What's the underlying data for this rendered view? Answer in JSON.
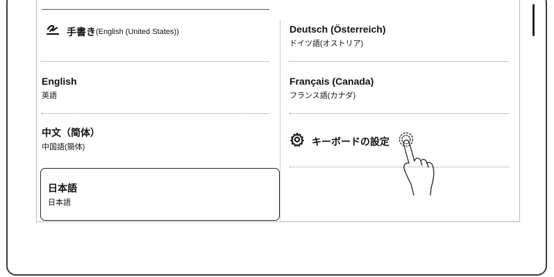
{
  "left_column": [
    {
      "title": "手書き",
      "title_suffix": "(English (United States))",
      "icon": "handwriting-icon",
      "sub": ""
    },
    {
      "title": "English",
      "sub": "英語"
    },
    {
      "title": "中文（简体）",
      "sub": "中国語(簡体)"
    },
    {
      "title": "日本語",
      "sub": "日本語",
      "selected": true
    }
  ],
  "right_column": [
    {
      "title": "Deutsch (Österreich)",
      "sub": "ドイツ語(オストリア)"
    },
    {
      "title": "Français (Canada)",
      "sub": "フランス語(カナダ)"
    },
    {
      "title": "キーボードの設定",
      "icon": "gear-icon"
    }
  ],
  "overlay": {
    "gesture": "tap-hand-icon"
  }
}
